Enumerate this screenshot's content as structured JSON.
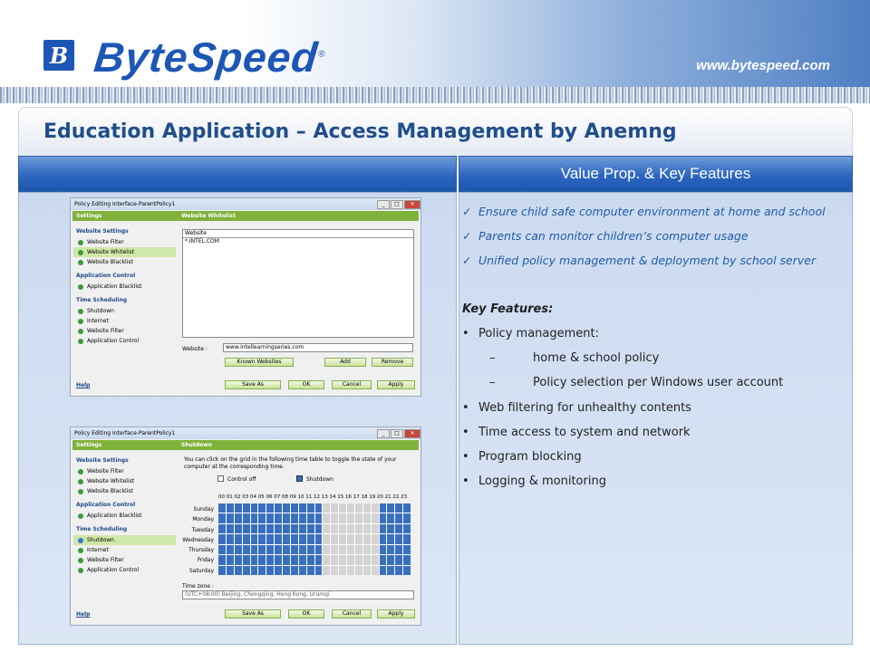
{
  "header": {
    "logo_letter": "B",
    "brand": "ByteSpeed",
    "reg": "®",
    "url": "www.bytespeed.com"
  },
  "title": "Education Application – Access Management by Anemng",
  "value_prop_header": "Value Prop. & Key Features",
  "value_props": [
    "Ensure child safe computer environment at home and school",
    "Parents can monitor children’s computer usage",
    "Unified policy management & deployment by school server"
  ],
  "key_features_heading": "Key Features:",
  "features": {
    "b1": "Policy management:",
    "d1": "home & school policy",
    "d2": "Policy selection per Windows user account",
    "b2": "Web filtering for unhealthy contents",
    "b3": "Time access to system and network",
    "b4": "Program blocking",
    "b5": "Logging & monitoring"
  },
  "win1": {
    "title": "Policy Editing Interface-ParentPolicy1",
    "settings": "Settings",
    "pane": "Website Whitelist",
    "col": "Website",
    "entry": "*.INTEL.COM",
    "site_label": "Website :",
    "site_value": "www.intellearningseries.com",
    "known": "Known Websites",
    "add": "Add",
    "remove": "Remove",
    "help": "Help",
    "save_as": "Save As",
    "ok": "OK",
    "cancel": "Cancel",
    "apply": "Apply"
  },
  "win2": {
    "title": "Policy Editing Interface-ParentPolicy1",
    "settings": "Settings",
    "pane": "Shutdown",
    "desc": "You can click on the grid in the following time table to toggle the state of your computer at the corresponding time.",
    "legend_off": "Control off",
    "legend_on": "Shutdown",
    "hours": "00 01 02 03 04 05 06 07 08 09 10 11 12 13 14 15 16 17 18 19 20 21 22 23",
    "days": [
      "Sunday",
      "Monday",
      "Tuesday",
      "Wednesday",
      "Thursday",
      "Friday",
      "Saturday"
    ],
    "tz_label": "Time zone :",
    "tz_value": "(UTC+08:00) Beijing, Chongqing, Hong Kong, Urumqi",
    "help": "Help",
    "save_as": "Save As",
    "ok": "OK",
    "cancel": "Cancel",
    "apply": "Apply"
  },
  "sidebar": {
    "g1": "Website Settings",
    "i1": "Website Filter",
    "i2": "Website Whitelist",
    "i3": "Website Blacklist",
    "g2": "Application Control",
    "i4": "Application Blacklist",
    "g3": "Time Scheduling",
    "i5": "Shutdown",
    "i6": "Internet",
    "i7": "Website Filter",
    "i8": "Application Control"
  }
}
